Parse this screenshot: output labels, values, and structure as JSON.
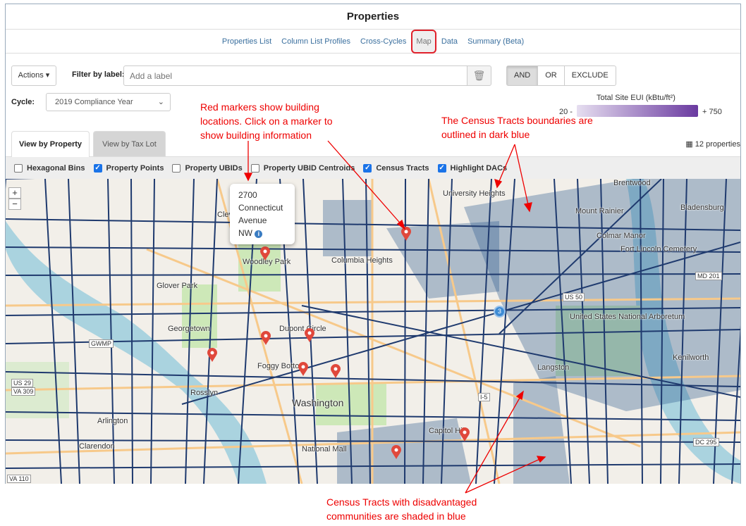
{
  "header": {
    "title": "Properties"
  },
  "nav": {
    "items": [
      "Properties List",
      "Column List Profiles",
      "Cross-Cycles",
      "Map",
      "Data",
      "Summary (Beta)"
    ],
    "active": "Map"
  },
  "toolbar": {
    "actions": "Actions ▾",
    "filter_label": "Filter by label:",
    "filter_placeholder": "Add a label",
    "and": "AND",
    "or": "OR",
    "exclude": "EXCLUDE",
    "cycle_label": "Cycle:",
    "cycle_value": "2019 Compliance Year"
  },
  "legend": {
    "title": "Total Site EUI (kBtu/ft²)",
    "min": "20 -",
    "max": "+ 750",
    "colors": [
      "#e6def0",
      "#6a3aa0"
    ]
  },
  "tabs": {
    "property": "View by Property",
    "taxlot": "View by Tax Lot",
    "count": "12 properties"
  },
  "layers": [
    {
      "label": "Hexagonal Bins",
      "checked": false
    },
    {
      "label": "Property Points",
      "checked": true
    },
    {
      "label": "Property UBIDs",
      "checked": false
    },
    {
      "label": "Property UBID Centroids",
      "checked": false
    },
    {
      "label": "Census Tracts",
      "checked": true
    },
    {
      "label": "Highlight DACs",
      "checked": true
    }
  ],
  "map": {
    "zoom_in": "+",
    "zoom_out": "−",
    "popup": {
      "lines": [
        "2700",
        "Connecticut",
        "Avenue",
        "NW"
      ],
      "info_icon": "i"
    },
    "cluster": "3",
    "places": [
      "University Heights",
      "Brentwood",
      "Bladensburg",
      "Mount Rainier",
      "Colmar Manor",
      "Fort Lincoln Cemetery",
      "Woodley Park",
      "Columbia Heights",
      "Glover Park",
      "Georgetown",
      "Dupont Circle",
      "Foggy Bottom",
      "Washington",
      "Rosslyn",
      "Arlington",
      "Clarendon",
      "Capitol Hill",
      "Langston",
      "Kenilworth",
      "National Mall",
      "Cleveland Park",
      "United States National Arboretum"
    ],
    "roads": [
      "US 50",
      "MD 201",
      "DC 295",
      "US 29",
      "VA 309",
      "GWMP",
      "VA 110",
      "I-5"
    ],
    "tract_color": "#1f3a6e",
    "dac_color": "#5a7fa8",
    "marker_color": "#e0483b"
  },
  "annotations": {
    "markers": "Red markers show building locations. Click on a marker to show building information",
    "tracts": "The Census Tracts boundaries are outlined in dark blue",
    "dacs": "Census Tracts with disadvantaged communities are shaded in blue"
  }
}
